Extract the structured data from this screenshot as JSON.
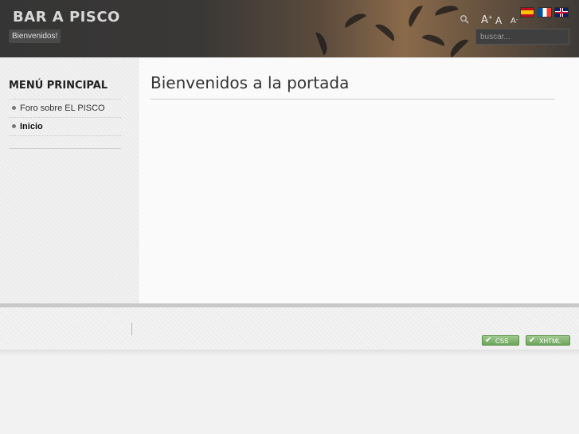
{
  "header": {
    "site_title": "BAR A PISCO",
    "greeting": "Bienvenidos!",
    "font_controls": {
      "increase": "A",
      "reset": "A",
      "decrease": "A",
      "increase_sup": "+",
      "decrease_sup": "-"
    },
    "search_placeholder": "buscar...",
    "languages": [
      "es",
      "fr",
      "en"
    ]
  },
  "sidebar": {
    "title": "MENÚ PRINCIPAL",
    "items": [
      {
        "label": "Foro sobre EL PISCO",
        "active": false
      },
      {
        "label": "Inicio",
        "active": true
      }
    ]
  },
  "main": {
    "title": "Bienvenidos a la portada"
  },
  "footer": {
    "badges": {
      "css": "CSS",
      "xhtml": "XHTML"
    }
  },
  "colors": {
    "header_bg": "#3a3836",
    "badge_green": "#7ab068"
  }
}
